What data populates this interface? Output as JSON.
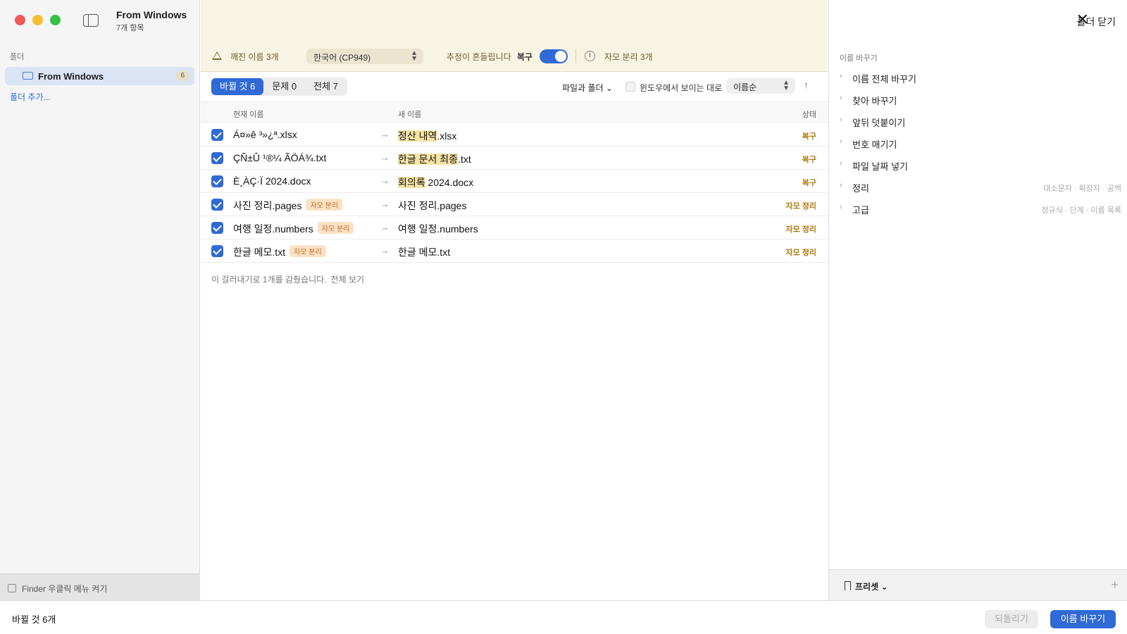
{
  "window": {
    "title": "From Windows",
    "subtitle": "7개 항목"
  },
  "sidebar": {
    "section": "폴더",
    "folder": {
      "label": "From Windows",
      "count": "6"
    },
    "add_folder": "폴더 추가...",
    "footer": "Finder 우클릭 메뉴 켜기"
  },
  "banner": {
    "broken_names": "깨진 이름 3개",
    "encoding": "한국어 (CP949)",
    "guess_note": "추정이 흔들립니다",
    "restore_label": "복구",
    "restore_on": true,
    "jamo_note": "자모 분리 3개"
  },
  "tabs": [
    "바뀔 것 6",
    "문제 0",
    "전체 7"
  ],
  "filters": {
    "type": "파일과 폴더",
    "windows_label": "윈도우에서 보이는 대로",
    "sort": "이름순"
  },
  "table": {
    "headers": {
      "current": "현재 이름",
      "new": "새 이름",
      "status": "상태"
    },
    "rows": [
      {
        "current": "Á¤»ê ³»¿ª.xlsx",
        "badge": "",
        "new_hl": "정산 내역",
        "new_rest": ".xlsx",
        "status": "복구"
      },
      {
        "current": "ÇÑ±Û ¹®¼­ ÃÖÁ¾.txt",
        "badge": "",
        "new_hl": "한글 문서 최종",
        "new_rest": ".txt",
        "status": "복구"
      },
      {
        "current": "È¸ÀÇ·Ï 2024.docx",
        "badge": "",
        "new_hl": "회의록",
        "new_rest": " 2024.docx",
        "status": "복구"
      },
      {
        "current": "사진 정리.pages",
        "badge": "자모 분리",
        "new_hl": "",
        "new_rest": "사진 정리.pages",
        "status": "자모 정리"
      },
      {
        "current": "여행 일정.numbers",
        "badge": "자모 분리",
        "new_hl": "",
        "new_rest": "여행 일정.numbers",
        "status": "자모 정리"
      },
      {
        "current": "한글 메모.txt",
        "badge": "자모 분리",
        "new_hl": "",
        "new_rest": "한글 메모.txt",
        "status": "자모 정리"
      }
    ],
    "hidden_note": "이 걸러내기로 1개를 감췄습니다.",
    "show_all": "전체 보기"
  },
  "right_panel": {
    "close_label": "폴더 닫기",
    "section": "이름 바꾸기",
    "items": [
      {
        "label": "이름 전체 바꾸기",
        "hint": ""
      },
      {
        "label": "찾아 바꾸기",
        "hint": ""
      },
      {
        "label": "앞뒤 덧붙이기",
        "hint": ""
      },
      {
        "label": "번호 매기기",
        "hint": ""
      },
      {
        "label": "파일 날짜 넣기",
        "hint": ""
      },
      {
        "label": "정리",
        "hint": "대소문자 · 확장자 · 공백"
      },
      {
        "label": "고급",
        "hint": "정규식 · 단계 · 이름 목록"
      }
    ],
    "presets": "프리셋"
  },
  "bottom": {
    "count": "바뀔 것 6개",
    "revert": "되돌리기",
    "rename": "이름 바꾸기"
  },
  "colors": {
    "accent": "#2f6ad6",
    "banner": "#f8f4e3",
    "status": "#b07a10",
    "badge": "#fbe2c7"
  }
}
